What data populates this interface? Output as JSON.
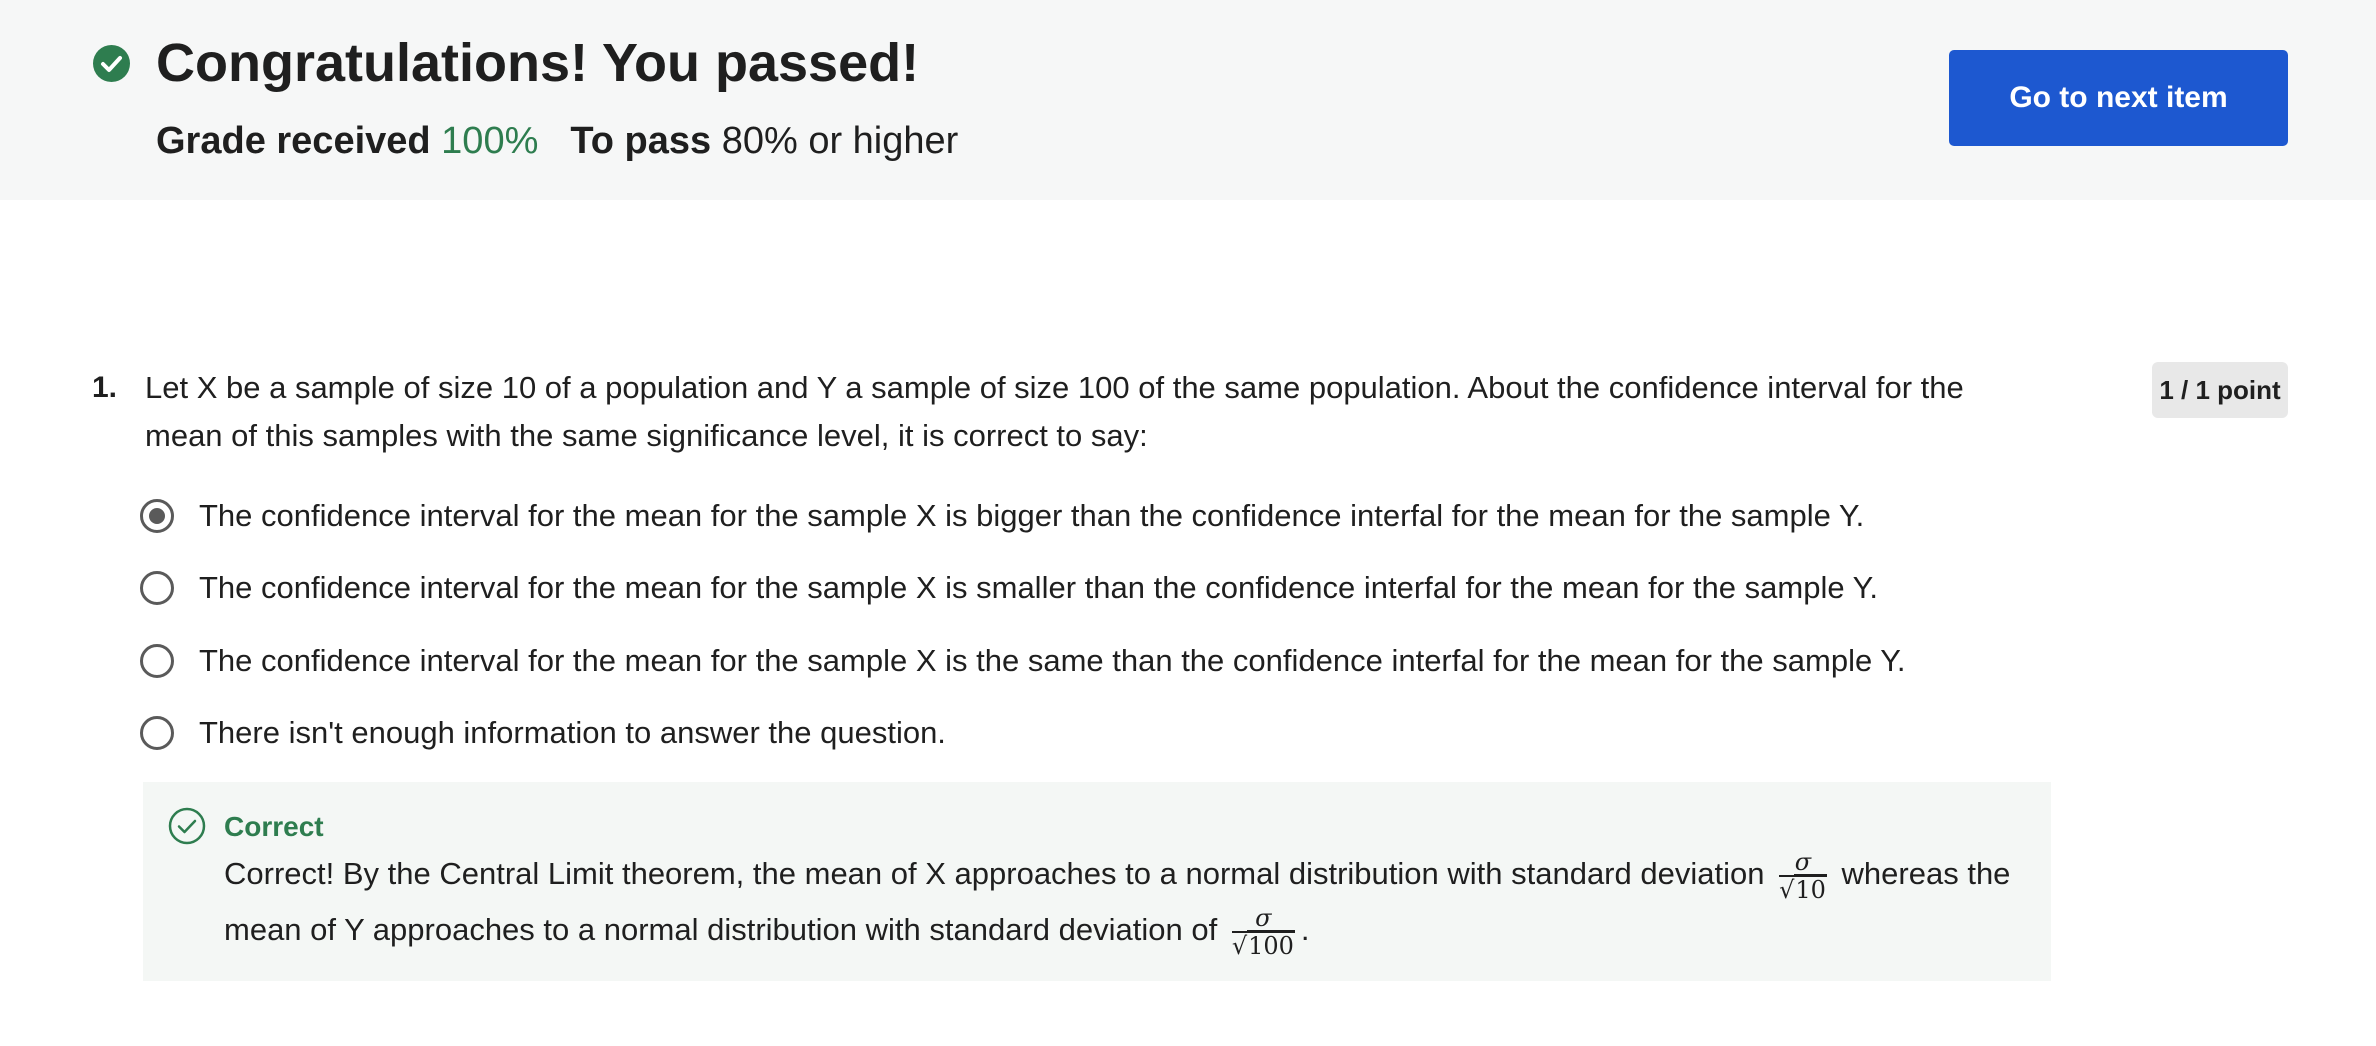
{
  "banner": {
    "title": "Congratulations! You passed!",
    "grade_label": "Grade received",
    "grade_value": "100%",
    "pass_label": "To pass",
    "pass_value": "80% or higher",
    "next_button_label": "Go to next item",
    "check_icon": "check-circle-filled-icon"
  },
  "question": {
    "number": "1.",
    "text": "Let X be a sample of size 10 of a population and Y a sample of size 100 of the same population. About the confidence interval for the mean of this samples with the same significance level, it is correct to say:",
    "points": "1 / 1 point",
    "options": [
      {
        "label": "The confidence interval for the mean for the sample X is bigger than the confidence interfal for the mean for the sample Y.",
        "selected": true
      },
      {
        "label": "The confidence interval for the mean for the sample X is smaller than the confidence interfal for the mean for the sample Y.",
        "selected": false
      },
      {
        "label": "The confidence interval for the mean for the sample X is the same than the confidence interfal for the mean for the sample Y.",
        "selected": false
      },
      {
        "label": "There isn't enough information to answer the question.",
        "selected": false
      }
    ]
  },
  "feedback": {
    "title": "Correct",
    "text_part1": "Correct! By the Central Limit theorem, the mean of X approaches to a normal distribution with standard deviation",
    "frac1_num": "σ",
    "frac1_den": "10",
    "text_part2": "whereas the mean of Y approaches to a normal distribution with standard deviation of",
    "frac2_num": "σ",
    "frac2_den": "100",
    "text_end": ".",
    "icon": "check-circle-outline-icon",
    "accent_color": "#2e7d4f"
  },
  "colors": {
    "banner_bg": "#f6f7f7",
    "primary_button": "#1d58d0",
    "success_green": "#2e7d4f",
    "feedback_bg": "#f4f7f5",
    "badge_bg": "#e8e8e8"
  }
}
